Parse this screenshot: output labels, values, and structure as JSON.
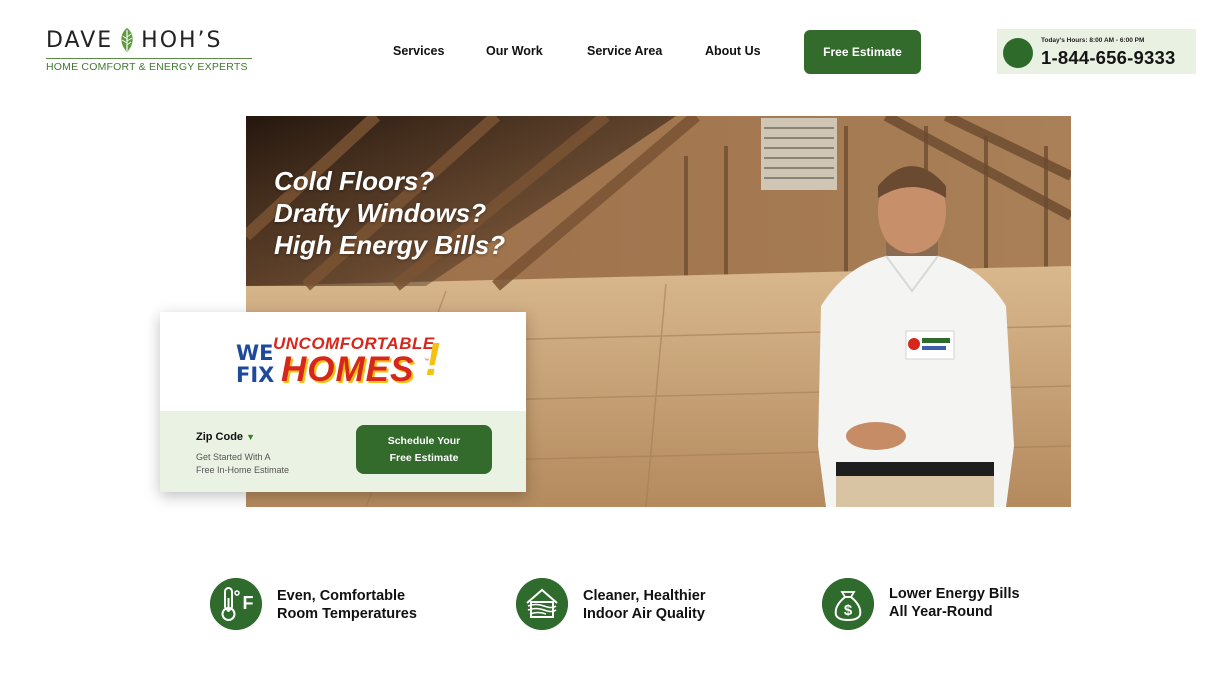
{
  "logo": {
    "name_left": "DAVE",
    "name_right": "HOH’S",
    "tagline": "HOME COMFORT & ENERGY EXPERTS"
  },
  "nav": {
    "items": [
      {
        "label": "Services"
      },
      {
        "label": "Our Work"
      },
      {
        "label": "Service Area"
      },
      {
        "label": "About Us"
      }
    ],
    "cta_label": "Free Estimate"
  },
  "contact": {
    "hours": "Today’s Hours: 8:00 AM - 6:00 PM",
    "phone": "1-844-656-9333"
  },
  "hero": {
    "headline": [
      "Cold Floors?",
      "Drafty Windows?",
      "High Energy Bills?"
    ]
  },
  "promo": {
    "logo_we_fix": [
      "WE",
      "FIX"
    ],
    "logo_uncomfortable": "UNCOMFORTABLE",
    "logo_homes": "HOMES",
    "logo_tm": "™",
    "zip_label": "Zip Code",
    "zip_sub": [
      "Get Started With A",
      "Free In-Home Estimate"
    ],
    "button_lines": [
      "Schedule Your",
      "Free Estimate"
    ]
  },
  "features": [
    {
      "icon": "thermometer-icon",
      "lines": [
        "Even, Comfortable",
        "Room Temperatures"
      ],
      "icon_text": "F"
    },
    {
      "icon": "house-air-icon",
      "lines": [
        "Cleaner, Healthier",
        "Indoor Air Quality"
      ]
    },
    {
      "icon": "money-bag-icon",
      "lines": [
        "Lower Energy Bills",
        "All Year-Round"
      ],
      "icon_text": "$"
    }
  ],
  "colors": {
    "brand_green": "#336b2c",
    "light_green": "#e9f2e3",
    "logo_red": "#d7261b",
    "logo_blue": "#1f4a9c",
    "logo_yellow": "#f3c212"
  }
}
